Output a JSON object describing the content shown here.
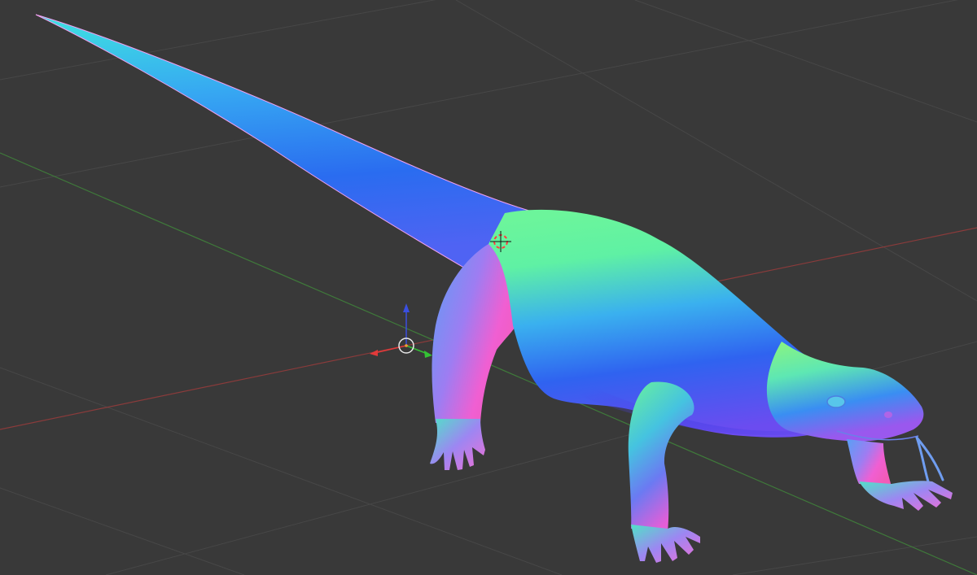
{
  "viewport": {
    "background": "#393939",
    "grid_color": "#474747",
    "x_axis_color": "#8a3b3b",
    "y_axis_color": "#3f7a3a",
    "gizmo_x_color": "#e23a3a",
    "gizmo_y_color": "#34c234",
    "gizmo_z_color": "#3a4fe0",
    "grid_visible": true
  },
  "scene": {
    "object": "lizard-mesh",
    "shading": "normal-map",
    "icons": [
      "3d-cursor-icon",
      "transform-gizmo-icon"
    ]
  }
}
